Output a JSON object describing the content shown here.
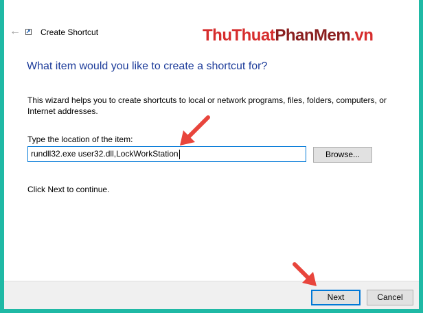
{
  "window": {
    "title": "Create Shortcut",
    "watermark": {
      "part1": "ThuThuat",
      "part2": "PhanMem",
      "part3": ".vn"
    }
  },
  "wizard": {
    "heading": "What item would you like to create a shortcut for?",
    "description": "This wizard helps you to create shortcuts to local or network programs, files, folders, computers, or Internet addresses.",
    "location_label": "Type the location of the item:",
    "location_value": "rundll32.exe user32.dll,LockWorkStation",
    "browse_label": "Browse...",
    "continue_text": "Click Next to continue."
  },
  "footer": {
    "next_label": "Next",
    "cancel_label": "Cancel"
  },
  "icons": {
    "back": "back-arrow-icon",
    "app": "shortcut-app-icon",
    "annotation": "red-pointer-arrow-icon"
  },
  "colors": {
    "frame": "#1fb9a5",
    "heading": "#1d3c9a",
    "accent": "#0078d7",
    "annotation": "#e8453c"
  }
}
